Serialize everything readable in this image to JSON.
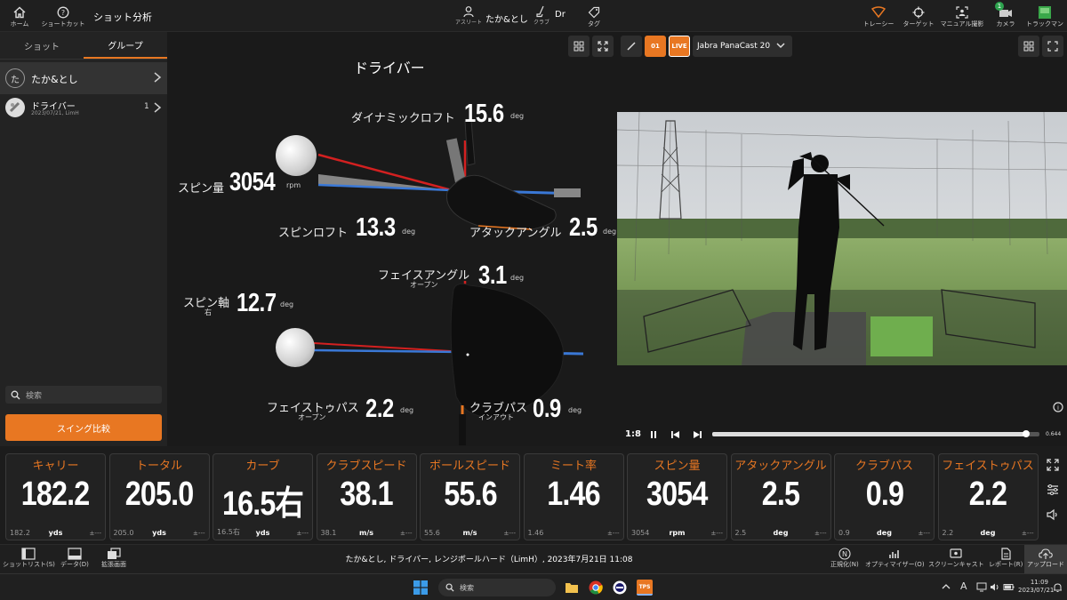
{
  "topbar": {
    "home": "ホーム",
    "shortcut": "ショートカット",
    "title": "ショット分析",
    "athlete_name": "たか&とし",
    "athlete_label": "アスリート",
    "club_name": "Dr",
    "club_label": "クラブ",
    "tag_label": "タグ",
    "tracer": "トレーシー",
    "target": "ターゲット",
    "manual": "マニュアル撮影",
    "camera": "カメラ",
    "camera_badge": "1",
    "trackman": "トラックマン"
  },
  "left": {
    "tab_shot": "ショット",
    "tab_group": "グループ",
    "player_avatar": "た",
    "player_name": "たか&とし",
    "group_name": "ドライバー",
    "group_date": "2023/07/21, LimH",
    "group_count": "1",
    "search_placeholder": "検索",
    "swing_compare": "スイング比較"
  },
  "center": {
    "title": "ドライバー",
    "dynamic_loft_label": "ダイナミックロフト",
    "dynamic_loft_value": "15.6",
    "dynamic_loft_unit": "deg",
    "spin_rate_label": "スピン量",
    "spin_rate_value": "3054",
    "spin_rate_unit": "rpm",
    "spin_loft_label": "スピンロフト",
    "spin_loft_value": "13.3",
    "spin_loft_unit": "deg",
    "attack_angle_label": "アタックアングル",
    "attack_angle_value": "2.5",
    "attack_angle_unit": "deg",
    "face_angle_label": "フェイスアングル",
    "face_angle_sub": "オープン",
    "face_angle_value": "3.1",
    "face_angle_unit": "deg",
    "spin_axis_label": "スピン軸",
    "spin_axis_sub": "右",
    "spin_axis_value": "12.7",
    "spin_axis_unit": "deg",
    "face_to_path_label": "フェイストゥパス",
    "face_to_path_sub": "オープン",
    "face_to_path_value": "2.2",
    "face_to_path_unit": "deg",
    "club_path_label": "クラブパス",
    "club_path_sub": "インアウト",
    "club_path_value": "0.9",
    "club_path_unit": "deg"
  },
  "right": {
    "rec_label": "01",
    "live_label": "LIVE",
    "camera_name": "Jabra PanaCast 20",
    "speed": "1:8",
    "time": "0.644",
    "progress": 0.96
  },
  "metrics": [
    {
      "title": "キャリー",
      "value": "182.2",
      "small": "182.2",
      "unit": "yds",
      "pm": "±---"
    },
    {
      "title": "トータル",
      "value": "205.0",
      "small": "205.0",
      "unit": "yds",
      "pm": "±---"
    },
    {
      "title": "カーブ",
      "value": "16.5右",
      "small": "16.5右",
      "unit": "yds",
      "pm": "±---"
    },
    {
      "title": "クラブスピード",
      "value": "38.1",
      "small": "38.1",
      "unit": "m/s",
      "pm": "±---"
    },
    {
      "title": "ボールスピード",
      "value": "55.6",
      "small": "55.6",
      "unit": "m/s",
      "pm": "±---"
    },
    {
      "title": "ミート率",
      "value": "1.46",
      "small": "1.46",
      "unit": "",
      "pm": "±---"
    },
    {
      "title": "スピン量",
      "value": "3054",
      "small": "3054",
      "unit": "rpm",
      "pm": "±---"
    },
    {
      "title": "アタックアングル",
      "value": "2.5",
      "small": "2.5",
      "unit": "deg",
      "pm": "±---"
    },
    {
      "title": "クラブパス",
      "value": "0.9",
      "small": "0.9",
      "unit": "deg",
      "pm": "±---"
    },
    {
      "title": "フェイストゥパス",
      "value": "2.2",
      "small": "2.2",
      "unit": "deg",
      "pm": "±---"
    }
  ],
  "bottom": {
    "shot_list": "ショットリスト(S)",
    "data": "データ(D)",
    "expand_screen": "拡張画面",
    "status": "たか&とし, ドライバー, レンジボールハード（LimH）, 2023年7月21日 11:08",
    "normalize": "正規化(N)",
    "optimizer": "オプティマイザー(O)",
    "screencast": "スクリーンキャスト",
    "report": "レポート(R)",
    "upload": "アップロード"
  },
  "taskbar": {
    "search": "検索",
    "app_label": "TPS",
    "ime": "A",
    "clock_time": "11:09",
    "clock_date": "2023/07/21"
  },
  "colors": {
    "accent": "#e87722",
    "panel": "#232323",
    "background": "#1a1a1a"
  }
}
